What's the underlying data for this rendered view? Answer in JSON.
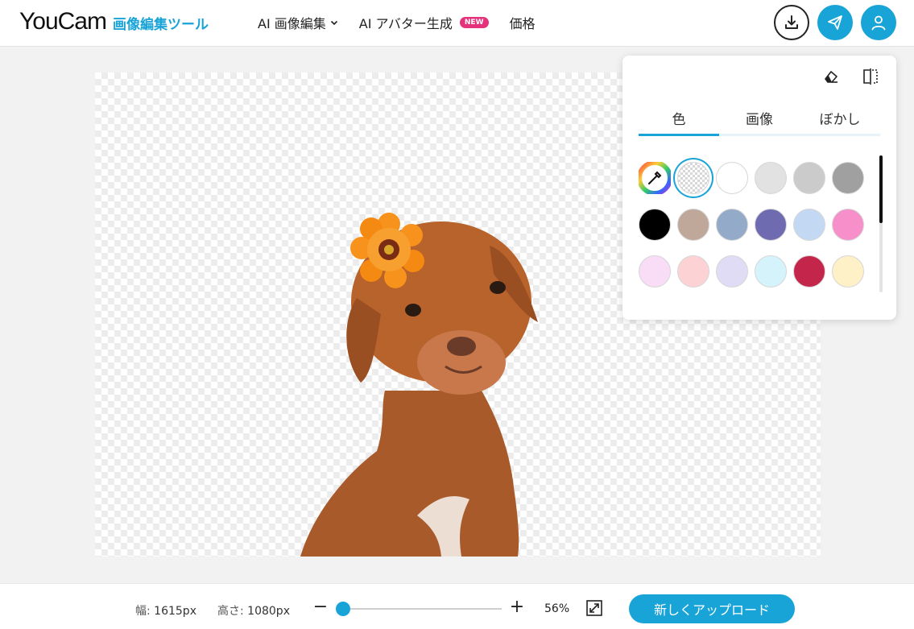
{
  "header": {
    "logo": "YouCam",
    "tagline": "画像編集ツール",
    "nav": [
      {
        "label": "AI 画像編集",
        "has_dropdown": true
      },
      {
        "label": "AI アバター生成",
        "badge": "NEW"
      },
      {
        "label": "価格"
      }
    ],
    "icons": [
      "download-icon",
      "send-icon",
      "user-icon"
    ]
  },
  "panel": {
    "tools": [
      "eraser-icon",
      "compare-icon"
    ],
    "tabs": [
      "色",
      "画像",
      "ぼかし"
    ],
    "active_tab": "色",
    "swatches": [
      "color-picker",
      "transparent",
      "#ffffff",
      "#e2e2e2",
      "#cbcbcb",
      "#a0a0a0",
      "#000000",
      "#bfa79a",
      "#93abc9",
      "#6f6bb0",
      "#c3d9f3",
      "#f78fcb",
      "#f9dcf6",
      "#fcd2d4",
      "#e0dcf6",
      "#d5f3fb",
      "#c4254b",
      "#fef1c8"
    ],
    "selected_swatch": "transparent"
  },
  "footer": {
    "width_label": "幅:",
    "width_value": "1615px",
    "height_label": "高さ:",
    "height_value": "1080px",
    "zoom_minus": "−",
    "zoom_plus": "+",
    "zoom_percent": 56,
    "zoom_label": "56%",
    "upload_label": "新しくアップロード"
  },
  "colors": {
    "accent": "#19a4d8",
    "badge": "#e4337b"
  }
}
